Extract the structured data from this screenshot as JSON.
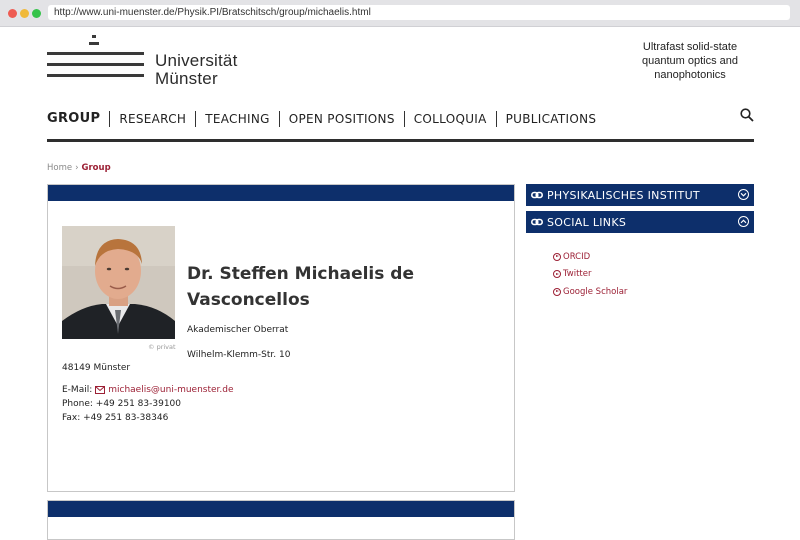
{
  "browser": {
    "url": "http://www.uni-muenster.de/Physik.PI/Bratschitsch/group/michaelis.html"
  },
  "header": {
    "logo_line1": "Universität",
    "logo_line2": "Münster",
    "tagline_line1": "Ultrafast solid-state",
    "tagline_line2": "quantum optics and",
    "tagline_line3": "nanophotonics"
  },
  "nav": {
    "items": [
      "GROUP",
      "RESEARCH",
      "TEACHING",
      "OPEN POSITIONS",
      "COLLOQUIA",
      "PUBLICATIONS"
    ],
    "search_icon": "search-icon"
  },
  "breadcrumb": {
    "home": "Home",
    "separator": "›",
    "current": "Group"
  },
  "profile": {
    "photo_credit": "© privat",
    "name": "Dr. Steffen Michaelis de Vasconcellos",
    "role": "Akademischer Oberrat",
    "street": "Wilhelm-Klemm-Str. 10",
    "city": "48149 Münster",
    "email_label": "E-Mail:",
    "email": "michaelis@uni-muenster.de",
    "phone": "Phone: +49 251 83-39100",
    "fax": "Fax: +49 251 83-38346"
  },
  "sidebar": {
    "section1": "PHYSIKALISCHES INSTITUT",
    "section2": "SOCIAL LINKS",
    "links": [
      "ORCID",
      "Twitter",
      "Google Scholar"
    ]
  },
  "colors": {
    "brand_blue": "#0d2f6b",
    "link_red": "#9c2035"
  }
}
